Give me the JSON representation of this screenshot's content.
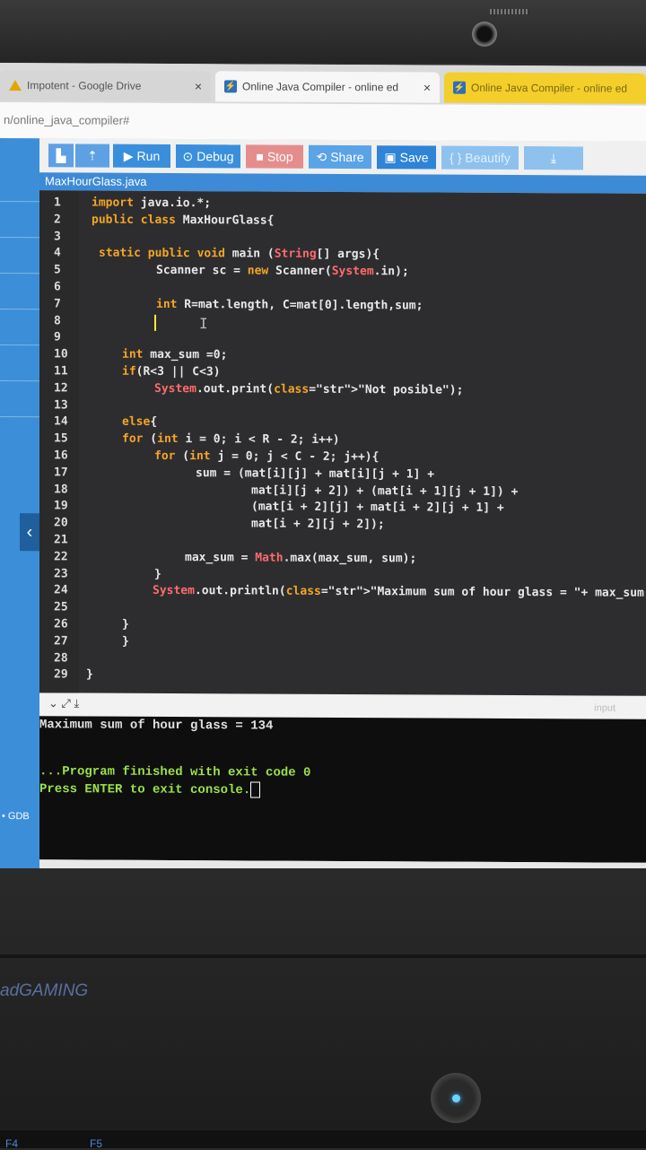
{
  "browser": {
    "tabs": [
      {
        "label": "Impotent - Google Drive",
        "close": "×"
      },
      {
        "label": "Online Java Compiler - online ed",
        "close": "×"
      },
      {
        "label": "Online Java Compiler - online ed"
      }
    ],
    "url": "n/online_java_compiler#"
  },
  "toolbar": {
    "run": "Run",
    "debug": "Debug",
    "stop": "Stop",
    "share": "Share",
    "save": "Save",
    "beautify": "{ } Beautify"
  },
  "editor": {
    "filename": "MaxHourGlass.java",
    "lines": [
      {
        "n": "1",
        "code": "import java.io.*;"
      },
      {
        "n": "2",
        "code": "public class MaxHourGlass{"
      },
      {
        "n": "3",
        "code": ""
      },
      {
        "n": "4",
        "code": "static public void main (String[] args){"
      },
      {
        "n": "5",
        "code": "Scanner sc = new Scanner(System.in);"
      },
      {
        "n": "6",
        "code": ""
      },
      {
        "n": "7",
        "code": "int R=mat.length, C=mat[0].length,sum;"
      },
      {
        "n": "8",
        "code": ""
      },
      {
        "n": "9",
        "code": ""
      },
      {
        "n": "10",
        "code": "int max_sum =0;"
      },
      {
        "n": "11",
        "code": "if(R<3 || C<3)"
      },
      {
        "n": "12",
        "code": "System.out.print(\"Not posible\");"
      },
      {
        "n": "13",
        "code": ""
      },
      {
        "n": "14",
        "code": "else{"
      },
      {
        "n": "15",
        "code": "for (int i = 0; i < R - 2; i++)"
      },
      {
        "n": "16",
        "code": "for (int j = 0; j < C - 2; j++){"
      },
      {
        "n": "17",
        "code": "sum = (mat[i][j] + mat[i][j + 1] +"
      },
      {
        "n": "18",
        "code": "mat[i][j + 2]) + (mat[i + 1][j + 1]) +"
      },
      {
        "n": "19",
        "code": "(mat[i + 2][j] + mat[i + 2][j + 1] +"
      },
      {
        "n": "20",
        "code": "mat[i + 2][j + 2]);"
      },
      {
        "n": "21",
        "code": ""
      },
      {
        "n": "22",
        "code": "max_sum = Math.max(max_sum, sum);"
      },
      {
        "n": "23",
        "code": "}"
      },
      {
        "n": "24",
        "code": "System.out.println(\"Maximum sum of hour glass = \"+ max_sum);"
      },
      {
        "n": "25",
        "code": ""
      },
      {
        "n": "26",
        "code": "}"
      },
      {
        "n": "27",
        "code": "}"
      },
      {
        "n": "28",
        "code": ""
      },
      {
        "n": "29",
        "code": "}"
      }
    ]
  },
  "console": {
    "input_label": "input",
    "output": "Maximum sum of hour glass = 134",
    "finished": "...Program finished with exit code 0",
    "press": "Press ENTER to exit console."
  },
  "sidebar": {
    "gdb": "• GDB"
  },
  "laptop": {
    "brand": "adGAMING",
    "keys": [
      "F4",
      "F5"
    ]
  }
}
